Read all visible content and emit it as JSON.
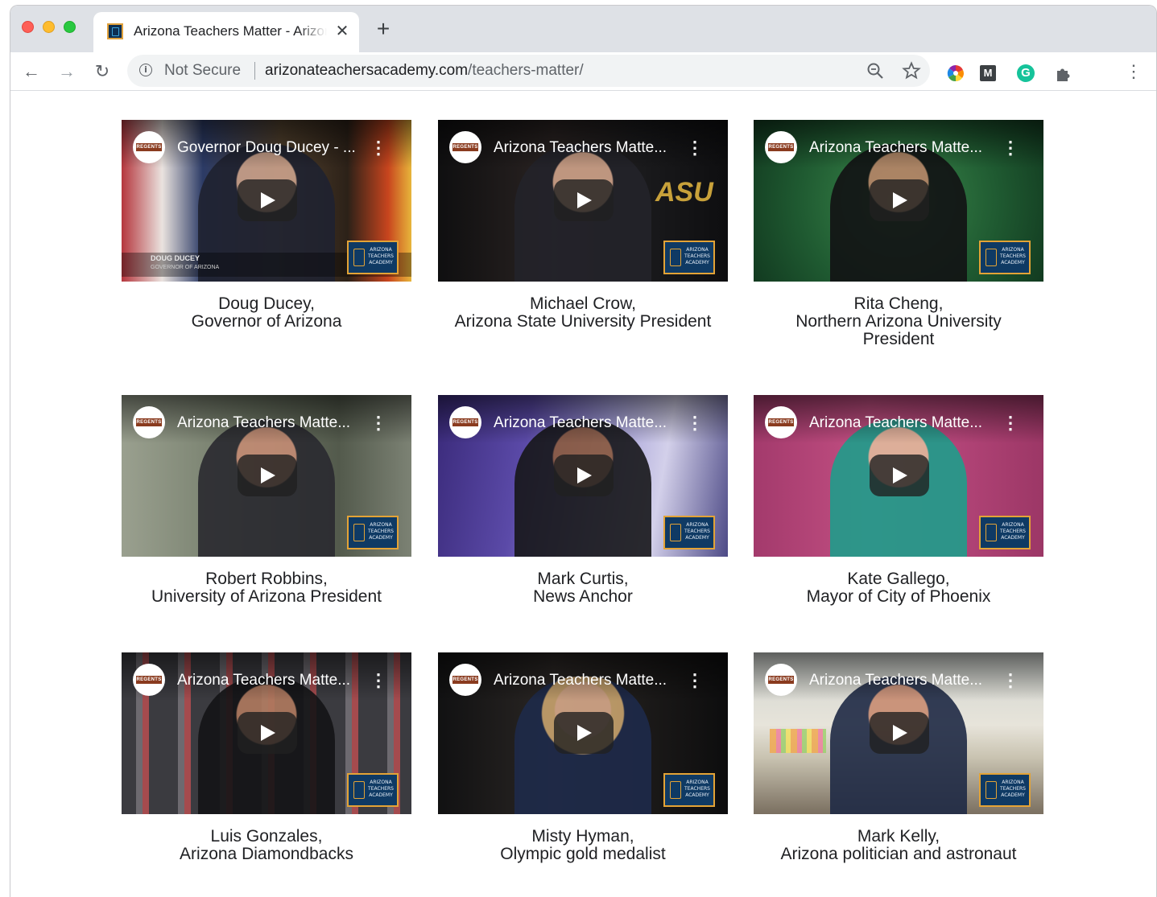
{
  "browser": {
    "tab_title": "Arizona Teachers Matter - Arizona Teachers Academy",
    "tab_close": "✕",
    "new_tab": "+",
    "nav": {
      "back": "←",
      "forward": "→",
      "reload": "↻",
      "menu": "⋮"
    },
    "omnibox": {
      "security_label": "Not Secure",
      "url_host": "arizonateachersacademy.com",
      "url_path": "/teachers-matter/"
    },
    "extensions": [
      "color-wheel",
      "monogram-m",
      "grammarly-g",
      "puzzle"
    ],
    "extension_labels": {
      "monogram": "M",
      "grammarly": "G"
    }
  },
  "video_common": {
    "channel_badge": "REGENTS",
    "logo_text": "ARIZONA TEACHERS ACADEMY",
    "kebab": "⋮"
  },
  "videos": [
    {
      "video_title": "Governor Doug Ducey - ...",
      "name_line": "Doug Ducey,",
      "role_line": "Governor of Arizona",
      "lower_third_name": "DOUG DUCEY",
      "lower_third_role": "GOVERNOR OF ARIZONA"
    },
    {
      "video_title": "Arizona Teachers Matte...",
      "name_line": "Michael Crow,",
      "role_line": "Arizona State University President",
      "bg_text": "ASU"
    },
    {
      "video_title": "Arizona Teachers Matte...",
      "name_line": "Rita Cheng,",
      "role_line": "Northern Arizona University",
      "role_line2": "President"
    },
    {
      "video_title": "Arizona Teachers Matte...",
      "name_line": "Robert Robbins,",
      "role_line": "University of Arizona President"
    },
    {
      "video_title": "Arizona Teachers Matte...",
      "name_line": "Mark Curtis,",
      "role_line": "News Anchor"
    },
    {
      "video_title": "Arizona Teachers Matte...",
      "name_line": "Kate Gallego,",
      "role_line": "Mayor of City of Phoenix"
    },
    {
      "video_title": "Arizona Teachers Matte...",
      "name_line": "Luis Gonzales,",
      "role_line": "Arizona Diamondbacks"
    },
    {
      "video_title": "Arizona Teachers Matte...",
      "name_line": "Misty Hyman,",
      "role_line": "Olympic gold medalist"
    },
    {
      "video_title": "Arizona Teachers Matte...",
      "name_line": "Mark Kelly,",
      "role_line": "Arizona politician and astronaut"
    }
  ]
}
